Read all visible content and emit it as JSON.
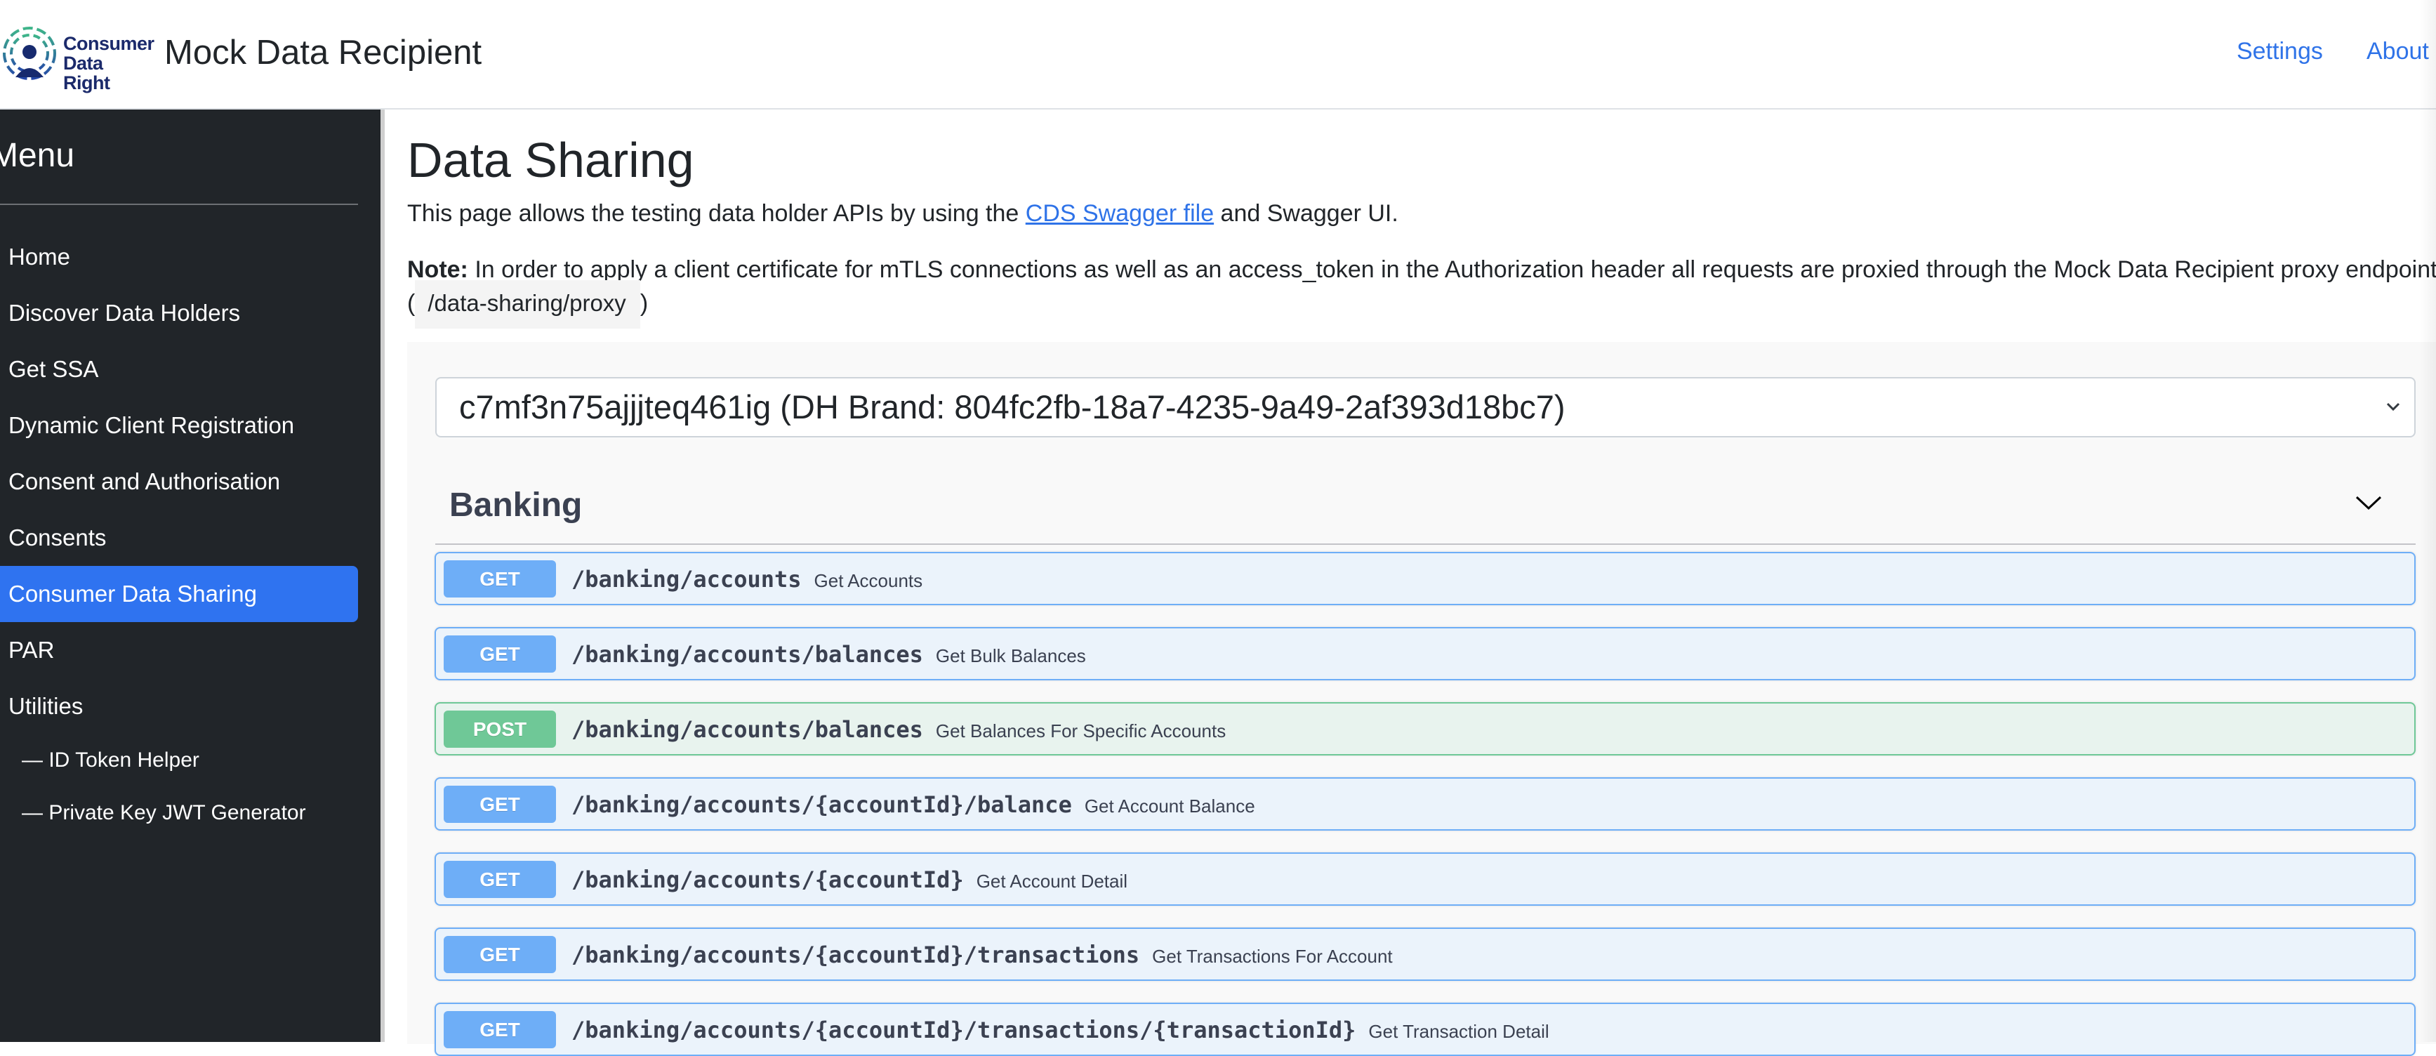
{
  "header": {
    "logo_line1": "Consumer",
    "logo_line2": "Data Right",
    "app_title": "Mock Data Recipient",
    "nav": [
      {
        "label": "Settings"
      },
      {
        "label": "About"
      }
    ]
  },
  "sidebar": {
    "title": "Menu",
    "items": [
      {
        "label": "Home"
      },
      {
        "label": "Discover Data Holders"
      },
      {
        "label": "Get SSA"
      },
      {
        "label": "Dynamic Client Registration"
      },
      {
        "label": "Consent and Authorisation"
      },
      {
        "label": "Consents"
      },
      {
        "label": "Consumer Data Sharing",
        "active": true
      },
      {
        "label": "PAR"
      },
      {
        "label": "Utilities"
      },
      {
        "label": "— ID Token Helper"
      },
      {
        "label": "— Private Key JWT Generator"
      }
    ]
  },
  "main": {
    "title": "Data Sharing",
    "intro_before": "This page allows the testing data holder APIs by using the ",
    "intro_link": "CDS Swagger file",
    "intro_after": " and Swagger UI.",
    "note_label": "Note:",
    "note_text": " In order to apply a client certificate for mTLS connections as well as an access_token in the Authorization header all requests are proxied through the Mock Data Recipient proxy endpoint",
    "proxy_open": "(",
    "proxy_path": "/data-sharing/proxy",
    "proxy_close": ")",
    "selected_data_holder": "c7mf3n75ajjjteq461ig (DH Brand: 804fc2fb-18a7-4235-9a49-2af393d18bc7)",
    "section": "Banking",
    "colors": {
      "get": "#6eaef7",
      "post": "#6fc897",
      "active_nav": "#2f73f0",
      "link": "#2f73e8"
    },
    "operations": [
      {
        "method": "GET",
        "path": "/banking/accounts",
        "summary": "Get Accounts"
      },
      {
        "method": "GET",
        "path": "/banking/accounts/balances",
        "summary": "Get Bulk Balances"
      },
      {
        "method": "POST",
        "path": "/banking/accounts/balances",
        "summary": "Get Balances For Specific Accounts"
      },
      {
        "method": "GET",
        "path": "/banking/accounts/{accountId}/balance",
        "summary": "Get Account Balance"
      },
      {
        "method": "GET",
        "path": "/banking/accounts/{accountId}",
        "summary": "Get Account Detail"
      },
      {
        "method": "GET",
        "path": "/banking/accounts/{accountId}/transactions",
        "summary": "Get Transactions For Account"
      },
      {
        "method": "GET",
        "path": "/banking/accounts/{accountId}/transactions/{transactionId}",
        "summary": "Get Transaction Detail"
      }
    ]
  }
}
